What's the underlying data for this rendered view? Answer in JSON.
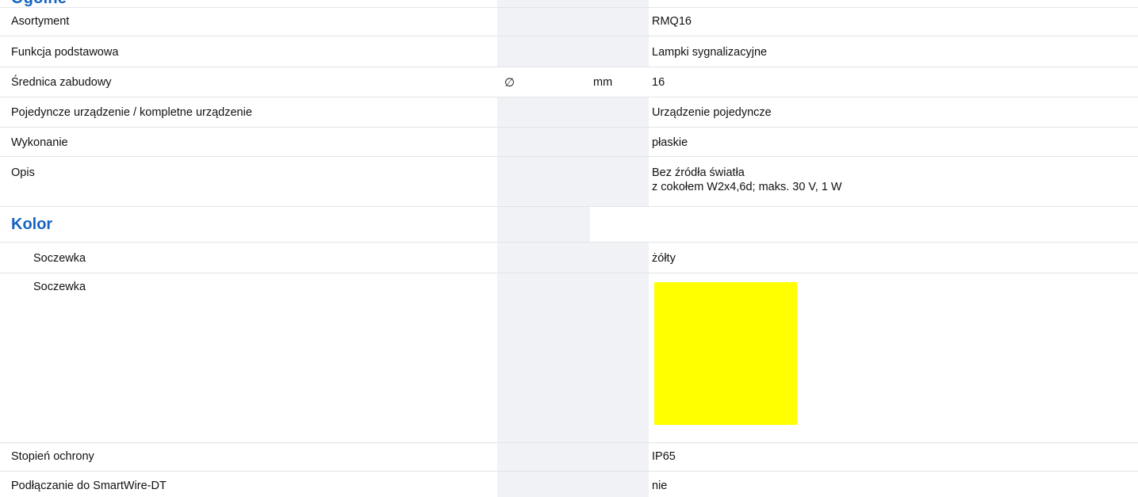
{
  "cut_heading": "Ogólne",
  "rows": {
    "asortyment": {
      "label": "Asortyment",
      "value": "RMQ16"
    },
    "funkcja": {
      "label": "Funkcja podstawowa",
      "value": "Lampki sygnalizacyjne"
    },
    "srednica": {
      "label": "Średnica zabudowy",
      "symbol": "∅",
      "unit": "mm",
      "value": "16"
    },
    "urzadzenie": {
      "label": "Pojedyncze urządzenie / kompletne urządzenie",
      "value": "Urządzenie pojedyncze"
    },
    "wykonanie": {
      "label": "Wykonanie",
      "value": "płaskie"
    },
    "opis": {
      "label": "Opis",
      "value_lines": [
        "Bez źródła światła",
        "z cokołem W2x4,6d; maks. 30 V, 1 W"
      ]
    },
    "kolor": {
      "label": "Kolor"
    },
    "soczewka_text": {
      "label": "Soczewka",
      "value": "żółty"
    },
    "soczewka_swatch": {
      "label": "Soczewka",
      "swatch_color": "#ffff00"
    },
    "stopien": {
      "label": "Stopień ochrony",
      "value": "IP65"
    },
    "smartwire": {
      "label": "Podłączanie do SmartWire-DT",
      "value": "nie"
    }
  }
}
